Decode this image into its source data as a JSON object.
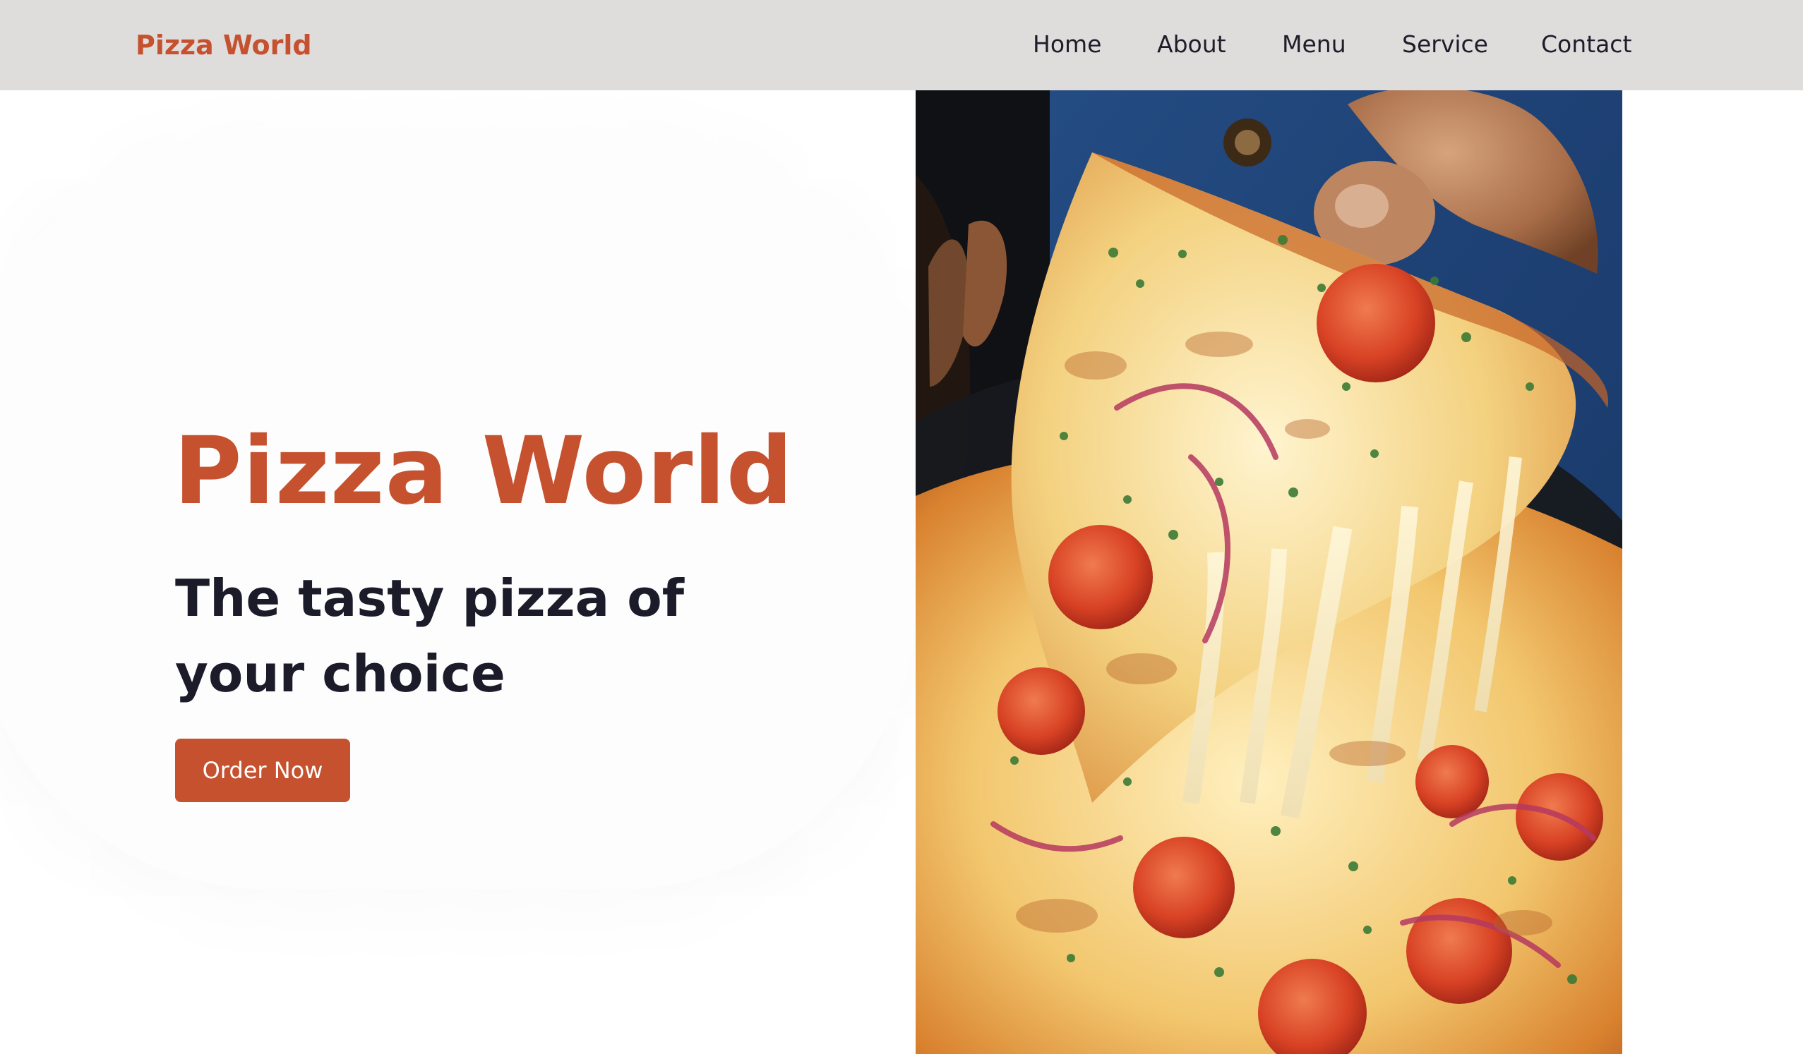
{
  "brand": {
    "name": "Pizza World",
    "color": "#c5512f"
  },
  "nav": {
    "background": "#dfdcdc",
    "links": [
      {
        "label": "Home"
      },
      {
        "label": "About"
      },
      {
        "label": "Menu"
      },
      {
        "label": "Service"
      },
      {
        "label": "Contact"
      }
    ]
  },
  "hero": {
    "title": "Pizza World",
    "subtitle": "The tasty pizza of your choice",
    "cta_label": "Order Now",
    "image_subject": "cheese-pull-pizza-slice",
    "colors": {
      "accent": "#c5512f",
      "text": "#1b1b29",
      "button_text": "#ffffff"
    }
  }
}
